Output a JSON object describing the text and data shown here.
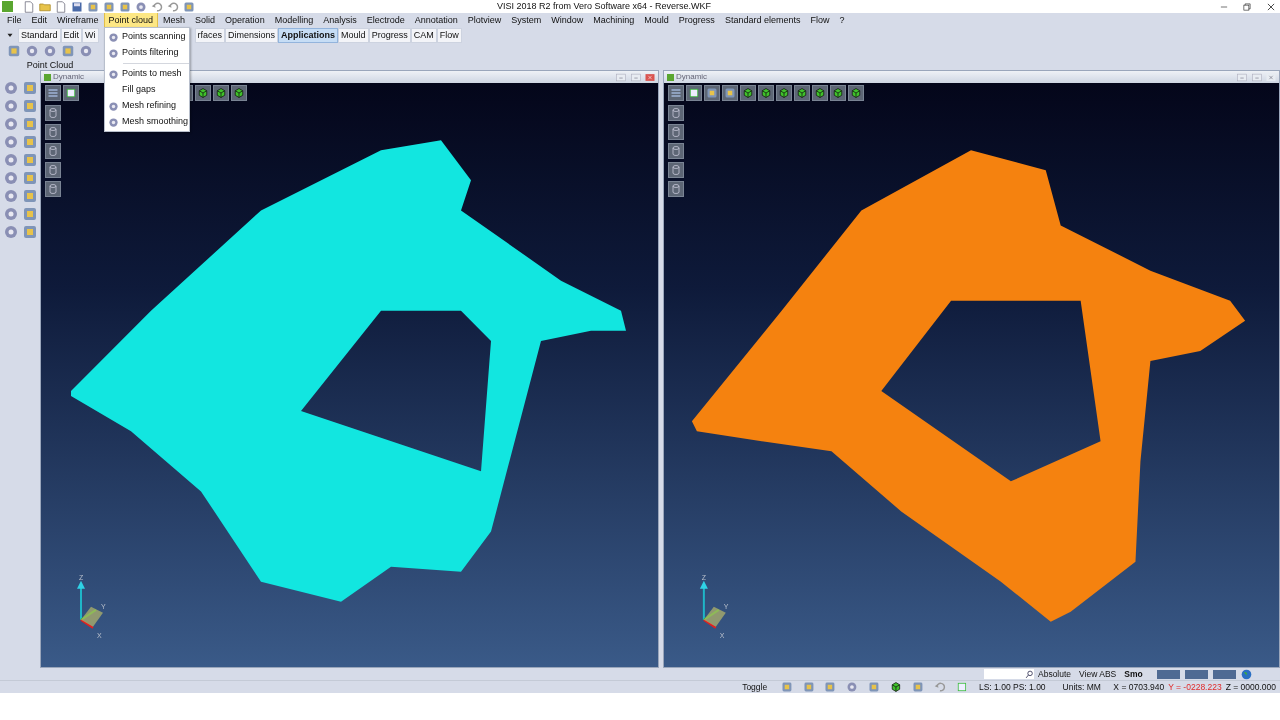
{
  "window": {
    "title": "VISI 2018 R2 from Vero Software x64 - Reverse.WKF"
  },
  "menu_bar": [
    {
      "label": "File",
      "selected": false
    },
    {
      "label": "Edit",
      "selected": false
    },
    {
      "label": "Wireframe",
      "selected": false
    },
    {
      "label": "Point cloud",
      "selected": true
    },
    {
      "label": "Mesh",
      "selected": false
    },
    {
      "label": "Solid",
      "selected": false
    },
    {
      "label": "Operation",
      "selected": false
    },
    {
      "label": "Modelling",
      "selected": false
    },
    {
      "label": "Analysis",
      "selected": false
    },
    {
      "label": "Electrode",
      "selected": false
    },
    {
      "label": "Annotation",
      "selected": false
    },
    {
      "label": "Plotview",
      "selected": false
    },
    {
      "label": "System",
      "selected": false
    },
    {
      "label": "Window",
      "selected": false
    },
    {
      "label": "Machining",
      "selected": false
    },
    {
      "label": "Mould",
      "selected": false
    },
    {
      "label": "Progress",
      "selected": false
    },
    {
      "label": "Standard elements",
      "selected": false
    },
    {
      "label": "Flow",
      "selected": false
    },
    {
      "label": "?",
      "selected": false
    }
  ],
  "ribbon": {
    "tabs_before_menu": [
      {
        "label": "Standard",
        "selected": false
      },
      {
        "label": "Edit",
        "selected": false
      },
      {
        "label": "Wi",
        "selected": false
      }
    ],
    "tabs_after_menu": [
      {
        "label": "rfaces",
        "selected": false
      },
      {
        "label": "Dimensions",
        "selected": false
      },
      {
        "label": "Applications",
        "selected": true
      },
      {
        "label": "Mould",
        "selected": false
      },
      {
        "label": "Progress",
        "selected": false
      },
      {
        "label": "CAM",
        "selected": false
      },
      {
        "label": "Flow",
        "selected": false
      }
    ],
    "group_label": "Point Cloud"
  },
  "dropdown": [
    {
      "kind": "item",
      "label": "Points scanning",
      "icon": true
    },
    {
      "kind": "item",
      "label": "Points filtering",
      "icon": true
    },
    {
      "kind": "separator"
    },
    {
      "kind": "item",
      "label": "Points to mesh",
      "icon": true
    },
    {
      "kind": "item",
      "label": "Fill gaps",
      "icon": false
    },
    {
      "kind": "item",
      "label": "Mesh refining",
      "icon": true
    },
    {
      "kind": "item",
      "label": "Mesh smoothing",
      "icon": true
    }
  ],
  "viewports": [
    {
      "title": "Dynamic",
      "kind": "point-cloud",
      "color": "#12e6e0",
      "axes": [
        "Z",
        "Y",
        "X"
      ]
    },
    {
      "title": "Dynamic",
      "kind": "mesh",
      "color": "#f5820f",
      "axes": [
        "Z",
        "Y",
        "X"
      ]
    }
  ],
  "status_bar": {
    "coord_system": "Absolute",
    "view": "View ABS",
    "shading": "Smo",
    "toggle": "Toggle",
    "scale": "LS: 1.00 PS: 1.00",
    "units": "Units: MM",
    "x": "X = 0703.940",
    "y": "Y = -0228.223",
    "z": "Z = 0000.000"
  }
}
